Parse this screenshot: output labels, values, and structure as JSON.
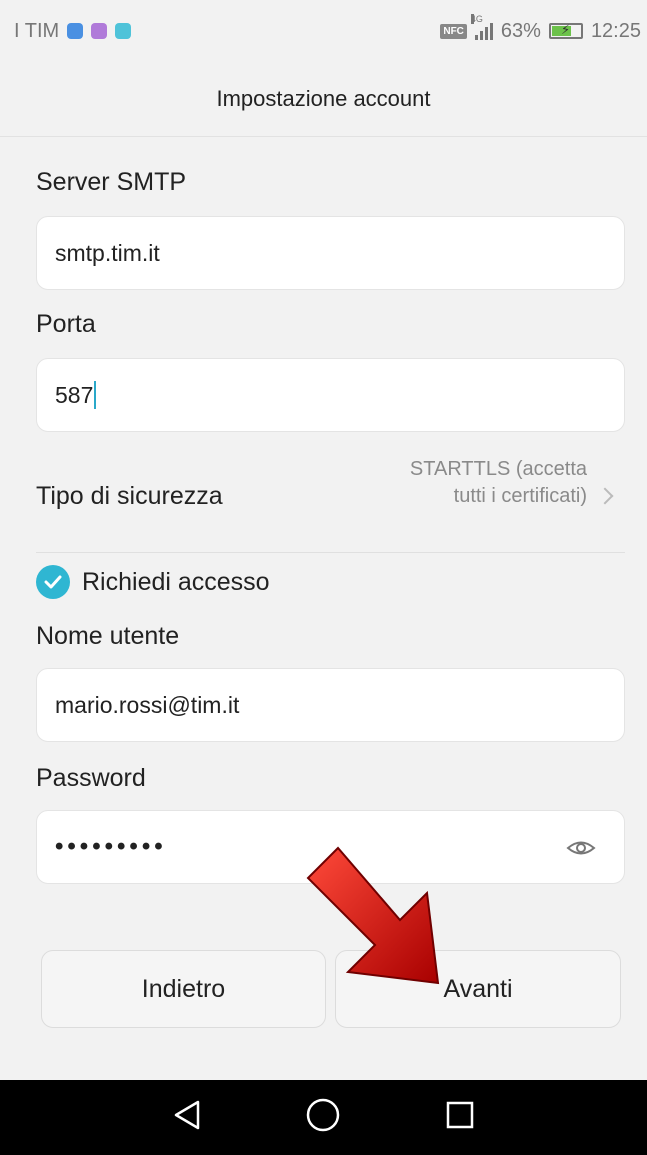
{
  "status_bar": {
    "carrier": "I TIM",
    "nfc": "NFC",
    "network": "4G",
    "battery_percent": "63%",
    "battery_level": 0.63,
    "time": "12:25",
    "app_icon_colors": [
      "#4a90e2",
      "#b07ad9",
      "#4fc3d9"
    ]
  },
  "header": {
    "title": "Impostazione account"
  },
  "smtp": {
    "label": "Server SMTP",
    "value": "smtp.tim.it"
  },
  "port": {
    "label": "Porta",
    "value": "587"
  },
  "security": {
    "label": "Tipo di sicurezza",
    "value": "STARTTLS (accetta tutti i certificati)"
  },
  "require_login": {
    "label": "Richiedi accesso",
    "checked": true
  },
  "username": {
    "label": "Nome utente",
    "value": "mario.rossi@tim.it"
  },
  "password": {
    "label": "Password",
    "masked_value": "•••••••••"
  },
  "buttons": {
    "back": "Indietro",
    "next": "Avanti"
  },
  "colors": {
    "accent": "#2fb6d2",
    "arrow": "#d01010"
  },
  "nav_icons": [
    "back-triangle-icon",
    "home-circle-icon",
    "recents-square-icon"
  ]
}
